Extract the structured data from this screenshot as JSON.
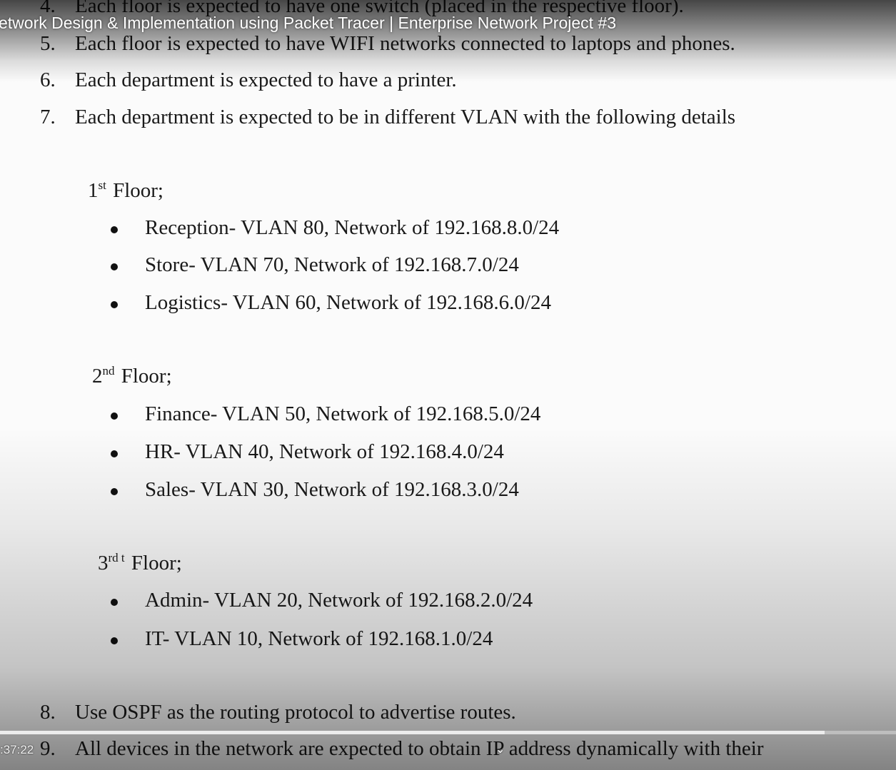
{
  "video": {
    "title": "etwork Design & Implementation using Packet Tracer | Enterprise Network Project #3",
    "time": ":37:22",
    "progress_fraction": 0.92,
    "chevron": "chevron-down-icon"
  },
  "items_top": [
    {
      "num": "4.",
      "text": "Each floor is expected to have one switch (placed in the respective floor)."
    },
    {
      "num": "5.",
      "text": "Each floor is expected to have WIFI networks connected to laptops and phones."
    },
    {
      "num": "6.",
      "text": "Each department is expected to have a printer."
    },
    {
      "num": "7.",
      "text": "Each department is expected to be in different VLAN with the following details"
    }
  ],
  "floors": [
    {
      "number": "1",
      "suffix": "st",
      "label": "Floor;",
      "bullets": [
        "Reception- VLAN 80, Network of 192.168.8.0/24",
        "Store- VLAN 70, Network of 192.168.7.0/24",
        "Logistics- VLAN 60, Network of 192.168.6.0/24"
      ]
    },
    {
      "number": "2",
      "suffix": "nd",
      "label": "Floor;",
      "bullets": [
        "Finance- VLAN 50, Network of 192.168.5.0/24",
        "HR- VLAN 40, Network of 192.168.4.0/24",
        "Sales- VLAN 30, Network of 192.168.3.0/24"
      ]
    },
    {
      "number": "3",
      "suffix": "rd t",
      "label": "Floor;",
      "bullets": [
        "Admin- VLAN 20, Network of 192.168.2.0/24",
        "IT- VLAN 10, Network of 192.168.1.0/24"
      ]
    }
  ],
  "items_bottom": [
    {
      "num": "8.",
      "text": "Use OSPF as the routing protocol to advertise routes."
    },
    {
      "num": "9.",
      "text": "All devices in the network are expected to obtain IP address dynamically with their"
    }
  ]
}
